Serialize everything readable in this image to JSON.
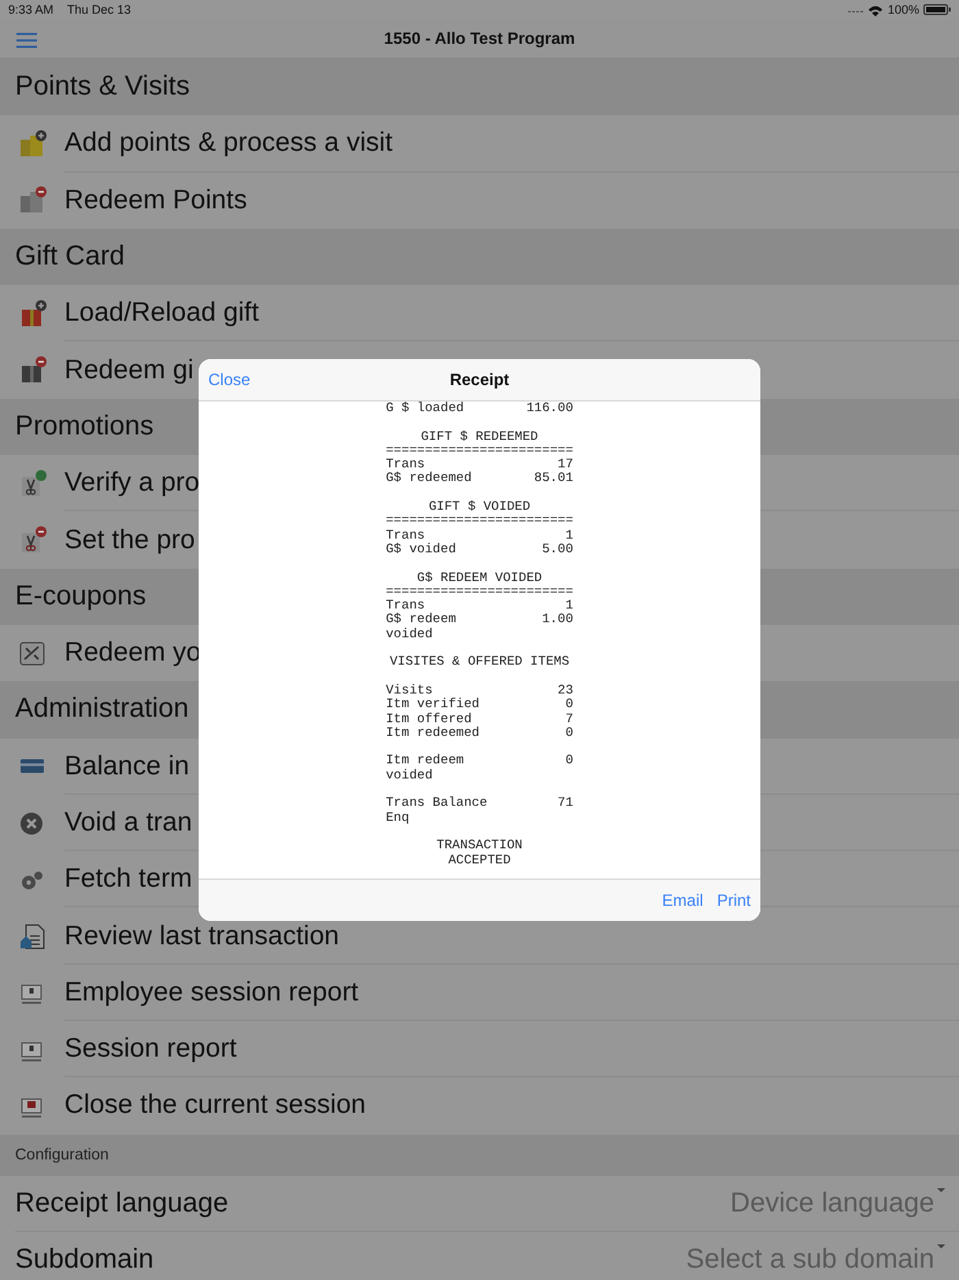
{
  "status_bar": {
    "time": "9:33 AM",
    "date": "Thu Dec 13",
    "battery": "100%"
  },
  "nav_bar": {
    "title": "1550 - Allo Test Program"
  },
  "sections": [
    {
      "title": "Points & Visits",
      "items": [
        {
          "label": "Add points & process a visit"
        },
        {
          "label": "Redeem Points"
        }
      ]
    },
    {
      "title": "Gift Card",
      "items": [
        {
          "label": "Load/Reload gift"
        },
        {
          "label": "Redeem gi"
        }
      ]
    },
    {
      "title": "Promotions",
      "items": [
        {
          "label": "Verify a pro"
        },
        {
          "label": "Set the pro"
        }
      ]
    },
    {
      "title": "E-coupons",
      "items": [
        {
          "label": "Redeem yo"
        }
      ]
    },
    {
      "title": "Administration",
      "items": [
        {
          "label": "Balance in"
        },
        {
          "label": "Void a tran"
        },
        {
          "label": "Fetch term"
        },
        {
          "label": "Review last transaction"
        },
        {
          "label": "Employee session report"
        },
        {
          "label": "Session report"
        },
        {
          "label": "Close the current session"
        }
      ]
    }
  ],
  "configuration": {
    "title": "Configuration",
    "settings": [
      {
        "label": "Receipt language",
        "value": "Device language"
      },
      {
        "label": "Subdomain",
        "placeholder": "Select a sub domain"
      }
    ]
  },
  "receipt_dialog": {
    "close": "Close",
    "title": "Receipt",
    "lines": [
      {
        "kind": "pair",
        "label": "G $ loaded",
        "value": "116.00"
      },
      {
        "kind": "gap"
      },
      {
        "kind": "heading",
        "text": "GIFT $ REDEEMED"
      },
      {
        "kind": "rule",
        "text": "========================"
      },
      {
        "kind": "pair",
        "label": "Trans",
        "value": "17"
      },
      {
        "kind": "pair",
        "label": "G$ redeemed",
        "value": "85.01"
      },
      {
        "kind": "gap"
      },
      {
        "kind": "heading",
        "text": "GIFT $ VOIDED"
      },
      {
        "kind": "rule",
        "text": "========================"
      },
      {
        "kind": "pair",
        "label": "Trans",
        "value": "1"
      },
      {
        "kind": "pair",
        "label": "G$ voided",
        "value": "5.00"
      },
      {
        "kind": "gap"
      },
      {
        "kind": "heading",
        "text": "G$ REDEEM VOIDED"
      },
      {
        "kind": "rule",
        "text": "========================"
      },
      {
        "kind": "pair",
        "label": "Trans",
        "value": "1"
      },
      {
        "kind": "pair",
        "label": "G$ redeem voided",
        "value": "1.00"
      },
      {
        "kind": "gap"
      },
      {
        "kind": "heading",
        "text": "VISITES & OFFERED ITEMS"
      },
      {
        "kind": "gap"
      },
      {
        "kind": "pair",
        "label": "Visits",
        "value": "23"
      },
      {
        "kind": "pair",
        "label": "Itm verified",
        "value": "0"
      },
      {
        "kind": "pair",
        "label": "Itm offered",
        "value": "7"
      },
      {
        "kind": "pair",
        "label": "Itm redeemed",
        "value": "0"
      },
      {
        "kind": "gap"
      },
      {
        "kind": "pair",
        "label": "Itm redeem voided",
        "value": "0"
      },
      {
        "kind": "gap"
      },
      {
        "kind": "pair",
        "label": "Trans Balance Enq",
        "value": "71"
      },
      {
        "kind": "gap"
      },
      {
        "kind": "heading",
        "text": "TRANSACTION"
      },
      {
        "kind": "heading",
        "text": "ACCEPTED"
      }
    ],
    "actions": [
      "Email",
      "Print"
    ]
  }
}
